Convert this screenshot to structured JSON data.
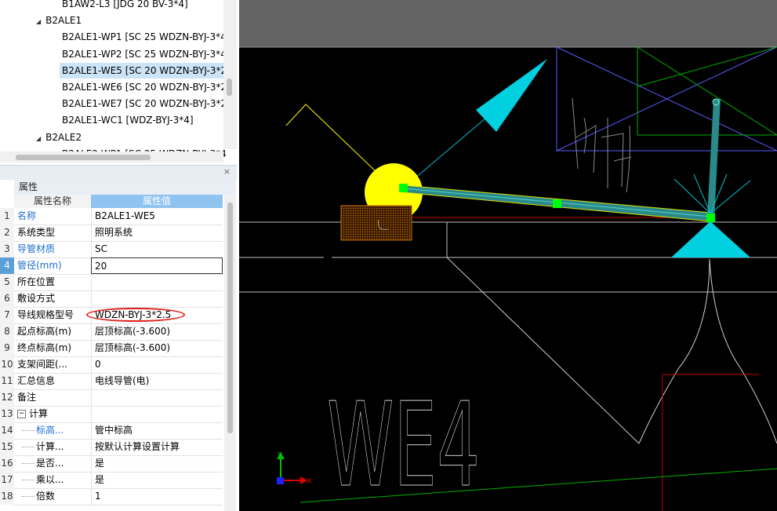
{
  "tree": {
    "items": [
      {
        "label": "B1AW2-L3 [JDG 20 BV-3*4]",
        "level": 2
      },
      {
        "label": "B2ALE1",
        "level": 1
      },
      {
        "label": "B2ALE1-WP1 [SC 25 WDZN-BYJ-3*4",
        "level": 2
      },
      {
        "label": "B2ALE1-WP2 [SC 25 WDZN-BYJ-3*4",
        "level": 2
      },
      {
        "label": "B2ALE1-WE5 [SC 20 WDZN-BYJ-3*2",
        "level": 2,
        "selected": true
      },
      {
        "label": "B2ALE1-WE6 [SC 20 WDZN-BYJ-3*2",
        "level": 2
      },
      {
        "label": "B2ALE1-WE7 [SC 20 WDZN-BYJ-3*2",
        "level": 2
      },
      {
        "label": "B2ALE1-WC1 [WDZ-BYJ-3*4]",
        "level": 2
      },
      {
        "label": "B2ALE2",
        "level": 1
      },
      {
        "label": "B2ALE2-WP1 [SC 25 WDZN-BYJ-3*4",
        "level": 2
      }
    ]
  },
  "panel": {
    "title": "属性",
    "close_glyph": "×"
  },
  "props": {
    "col_name": "属性名称",
    "col_value": "属性值",
    "rows": [
      {
        "num": "1",
        "name": "名称",
        "value": "B2ALE1-WE5",
        "blue": true
      },
      {
        "num": "2",
        "name": "系统类型",
        "value": "照明系统"
      },
      {
        "num": "3",
        "name": "导管材质",
        "value": "SC",
        "blue": true
      },
      {
        "num": "4",
        "name": "管径(mm)",
        "value": "20",
        "blue": true,
        "editing": true
      },
      {
        "num": "5",
        "name": "所在位置",
        "value": ""
      },
      {
        "num": "6",
        "name": "敷设方式",
        "value": ""
      },
      {
        "num": "7",
        "name": "导线规格型号",
        "value": "WDZN-BYJ-3*2.5"
      },
      {
        "num": "8",
        "name": "起点标高(m)",
        "value": "层顶标高(-3.600)"
      },
      {
        "num": "9",
        "name": "终点标高(m)",
        "value": "层顶标高(-3.600)"
      },
      {
        "num": "10",
        "name": "支架间距(...",
        "value": "0"
      },
      {
        "num": "11",
        "name": "汇总信息",
        "value": "电线导管(电)"
      },
      {
        "num": "12",
        "name": "备注",
        "value": ""
      },
      {
        "num": "13",
        "name": "计算",
        "value": "",
        "group": true
      },
      {
        "num": "14",
        "name": "标高...",
        "value": "管中标高",
        "blue": true,
        "child": true
      },
      {
        "num": "15",
        "name": "计算...",
        "value": "按默认计算设置计算",
        "child": true
      },
      {
        "num": "16",
        "name": "是否...",
        "value": "是",
        "child": true
      },
      {
        "num": "17",
        "name": "乘以...",
        "value": "是",
        "child": true
      },
      {
        "num": "18",
        "name": "倍数",
        "value": "1",
        "child": true
      }
    ]
  },
  "cad": {
    "text_label": "WE4",
    "axis_y": "Y",
    "axis_x": "X",
    "colors": {
      "background": "#000000",
      "top_band": "#636363",
      "yellow": "#ffff00",
      "cyan": "#00d0e0",
      "conduit": "#2a8a8a",
      "grip": "#00ff00",
      "white_line": "#bfbfbf",
      "blue_frame": "#5a5aff",
      "green_frame": "#00b000",
      "red_line": "#c00000",
      "hatch": "#c07000"
    }
  }
}
